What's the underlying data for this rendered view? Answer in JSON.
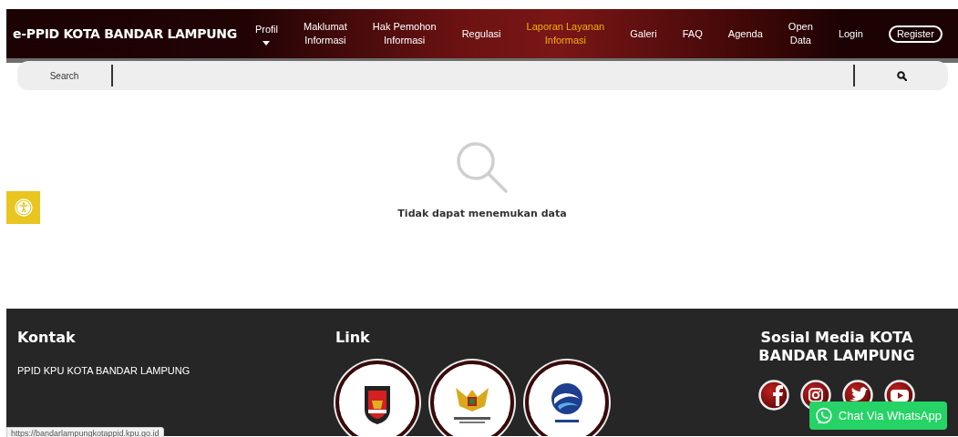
{
  "header": {
    "brand": "e-PPID KOTA BANDAR LAMPUNG",
    "nav": [
      {
        "label": "Profil",
        "kind": "dropdown",
        "selected": false
      },
      {
        "label": "Maklumat\nInformasi",
        "kind": "link",
        "selected": false
      },
      {
        "label": "Hak Pemohon\nInformasi",
        "kind": "link",
        "selected": false
      },
      {
        "label": "Regulasi",
        "kind": "link",
        "selected": false
      },
      {
        "label": "Laporan Layanan\nInformasi",
        "kind": "link",
        "selected": true
      },
      {
        "label": "Galeri",
        "kind": "link",
        "selected": false
      },
      {
        "label": "FAQ",
        "kind": "link",
        "selected": false
      },
      {
        "label": "Agenda",
        "kind": "link",
        "selected": false
      },
      {
        "label": "Open\nData",
        "kind": "link",
        "selected": false
      },
      {
        "label": "Login",
        "kind": "link",
        "selected": false
      },
      {
        "label": "Register",
        "kind": "outline",
        "selected": false
      }
    ]
  },
  "search": {
    "label": "Search"
  },
  "empty_state": {
    "message": "Tidak dapat menemukan data"
  },
  "footer": {
    "contact": {
      "title": "Kontak",
      "name": "PPID KPU KOTA BANDAR LAMPUNG"
    },
    "links": {
      "title": "Link"
    },
    "social": {
      "title": "Sosial Media KOTA BANDAR LAMPUNG",
      "icons": [
        {
          "kind": "facebook"
        },
        {
          "kind": "instagram"
        },
        {
          "kind": "twitter"
        },
        {
          "kind": "youtube"
        }
      ]
    }
  },
  "whatsapp_button": {
    "label": "Chat Via WhatsApp"
  },
  "status_url": "https://bandarlampungkotappid.kpu.go.id"
}
